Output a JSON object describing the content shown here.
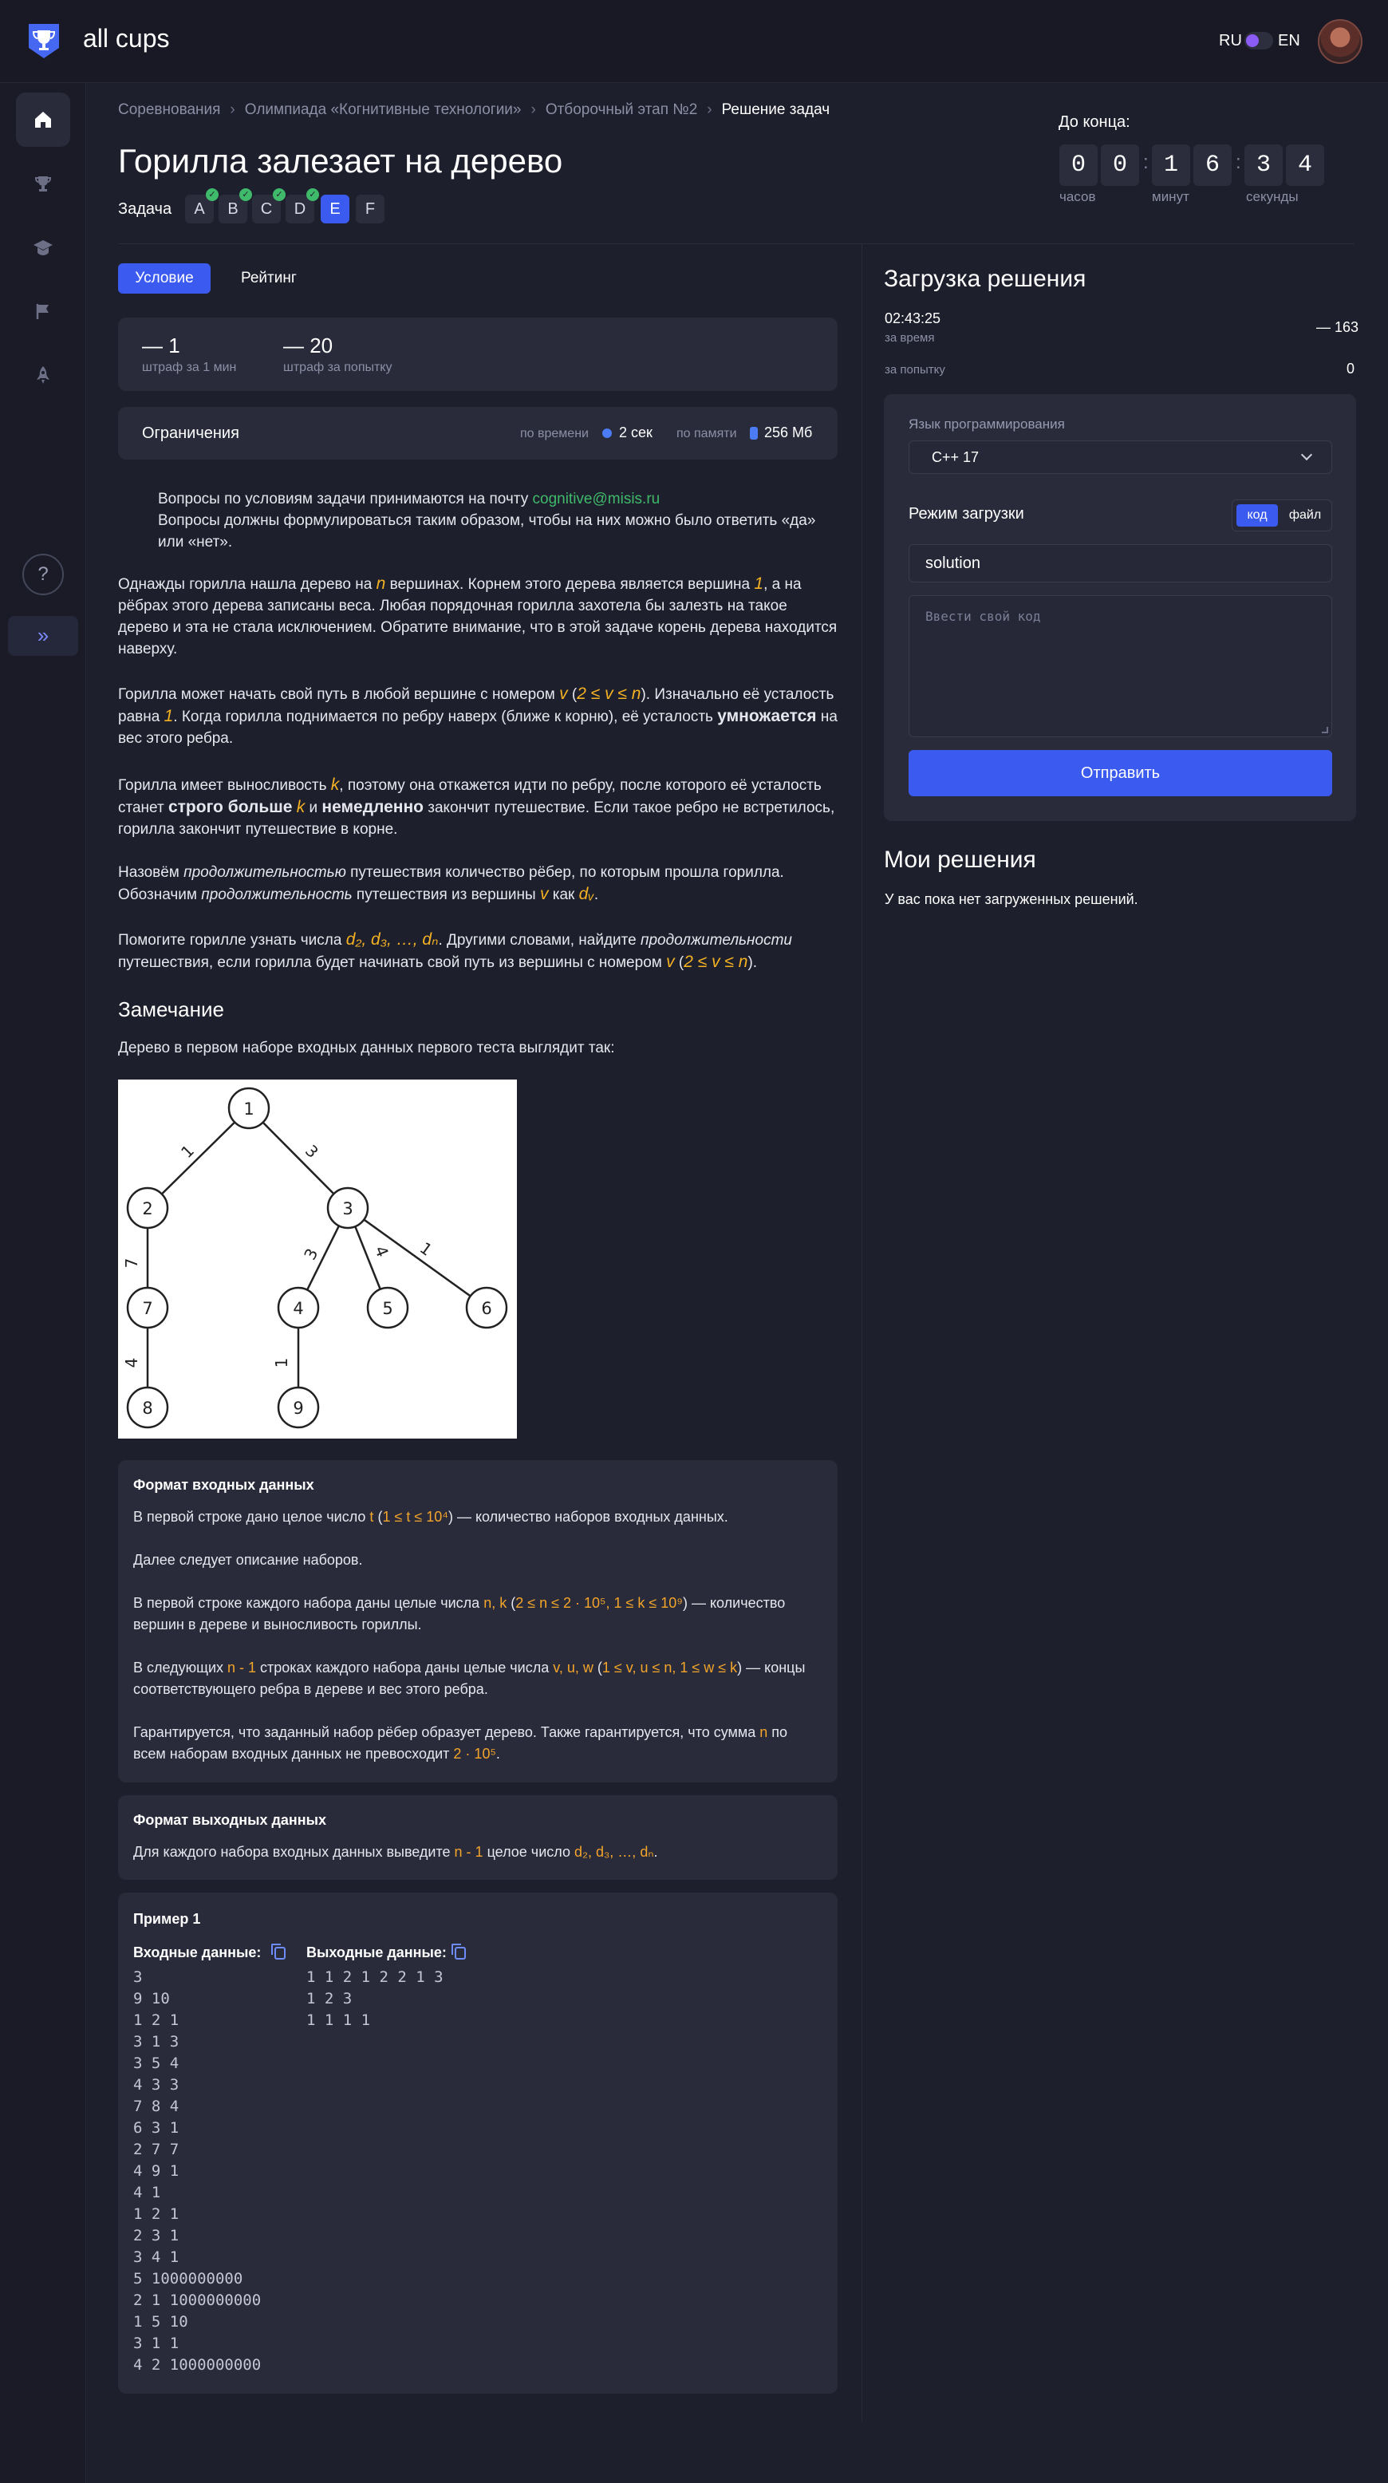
{
  "header": {
    "logo_text": "all cups",
    "lang_ru": "RU",
    "lang_en": "EN"
  },
  "sidebar": {
    "items": [
      "home-icon",
      "trophy-icon",
      "hat-icon",
      "flag-icon",
      "rocket-icon"
    ],
    "help": "?",
    "expand": "»"
  },
  "breadcrumbs": [
    "Соревнования",
    "Олимпиада «Когнитивные технологии»",
    "Отборочный этап №2",
    "Решение задач"
  ],
  "problem": {
    "title": "Горилла залезает на дерево",
    "task_label": "Задача",
    "tasks": [
      {
        "letter": "A",
        "solved": true
      },
      {
        "letter": "B",
        "solved": true
      },
      {
        "letter": "C",
        "solved": true
      },
      {
        "letter": "D",
        "solved": true
      },
      {
        "letter": "E",
        "solved": false,
        "current": true
      },
      {
        "letter": "F",
        "solved": false
      }
    ]
  },
  "timer": {
    "label": "До конца:",
    "digits": [
      "0",
      "0",
      "1",
      "6",
      "3",
      "4"
    ],
    "units": [
      "часов",
      "минут",
      "секунды"
    ]
  },
  "tabs": {
    "condition": "Условие",
    "rating": "Рейтинг"
  },
  "penalties": {
    "per_minute_value": "— 1",
    "per_minute_caption": "штраф за 1 мин",
    "per_attempt_value": "— 20",
    "per_attempt_caption": "штраф за попытку"
  },
  "limits": {
    "title": "Ограничения",
    "time_caption": "по времени",
    "time_value": "2 сек",
    "memory_caption": "по памяти",
    "memory_value": "256 Мб"
  },
  "notice": {
    "line1": "Вопросы по условиям задачи принимаются на почту ",
    "email": "cognitive@misis.ru",
    "line2": "Вопросы должны формулироваться таким образом, чтобы на них можно было ответить «да» или «нет»."
  },
  "statement": {
    "p1_a": "Однажды горилла нашла дерево на ",
    "p1_n": "n",
    "p1_b": " вершинах. Корнем этого дерева является вершина ",
    "p1_one": "1",
    "p1_c": ", а на рёбрах этого дерева записаны веса. Любая порядочная горилла захотела бы залезть на такое дерево и эта не стала исключением. Обратите внимание, что в этой задаче корень дерева находится наверху.",
    "p2_a": "Горилла может начать свой путь в любой вершине с номером ",
    "p2_v": "v",
    "p2_open": " (",
    "p2_range": "2 ≤ v ≤ n",
    "p2_b": "). Изначально её усталость равна ",
    "p2_one": "1",
    "p2_c": ". Когда горилла поднимается по ребру наверх (ближе к корню), её усталость ",
    "p2_bold": "умножается",
    "p2_d": " на вес этого ребра.",
    "p3_a": "Горилла имеет выносливость ",
    "p3_k": "k",
    "p3_b": ", поэтому она откажется идти по ребру, после которого её усталость станет ",
    "p3_bold1": "строго больше",
    "p3_k2": "k",
    "p3_and": " и ",
    "p3_bold2": "немедленно",
    "p3_c": " закончит путешествие. Если такое ребро не встретилось, горилла закончит путешествие в корне.",
    "p4_a": "Назовём ",
    "p4_i1": "продолжительностью",
    "p4_b": " путешествия количество рёбер, по которым прошла горилла. Обозначим ",
    "p4_i2": "продолжительность",
    "p4_c": " путешествия из вершины ",
    "p4_v": "v",
    "p4_as": " как ",
    "p4_dv": "dᵥ",
    "p4_end": ".",
    "p5_a": "Помогите горилле узнать числа ",
    "p5_d": "d₂, d₃, …, dₙ",
    "p5_b": ". Другими словами, найдите ",
    "p5_i": "продолжительности",
    "p5_c": " путешествия, если горилла будет начинать свой путь из вершины с номером ",
    "p5_v": "v",
    "p5_open": " (",
    "p5_range": "2 ≤ v ≤ n",
    "p5_end": ")."
  },
  "note": {
    "title": "Замечание",
    "text": "Дерево в первом наборе входных данных первого теста выглядит так:"
  },
  "tree": {
    "nodes": [
      "1",
      "2",
      "3",
      "4",
      "5",
      "6",
      "7",
      "8",
      "9"
    ],
    "edge_weights": [
      "1",
      "3",
      "7",
      "3",
      "4",
      "1",
      "4",
      "1"
    ]
  },
  "input_format": {
    "title": "Формат входных данных",
    "p1_a": "В первой строке дано целое число ",
    "p1_t": "t",
    "p1_open": " (",
    "p1_range": "1 ≤ t ≤ 10⁴",
    "p1_b": ") — количество наборов входных данных.",
    "p2": "Далее следует описание наборов.",
    "p3_a": "В первой строке каждого набора даны целые числа ",
    "p3_nk": "n, k",
    "p3_open": " (",
    "p3_range": "2 ≤ n ≤ 2 · 10⁵, 1 ≤ k ≤ 10⁹",
    "p3_b": ") — количество вершин в дереве и выносливость гориллы.",
    "p4_a": "В следующих ",
    "p4_n": "n - 1",
    "p4_b": " строках каждого набора даны целые числа ",
    "p4_vars": "v, u, w",
    "p4_open": " (",
    "p4_range": "1 ≤ v, u ≤ n, 1 ≤ w ≤ k",
    "p4_c": ") — концы соответствующего ребра в дереве и вес этого ребра.",
    "p5_a": "Гарантируется, что заданный набор рёбер образует дерево. Также гарантируется, что сумма ",
    "p5_n": "n",
    "p5_b": " по всем наборам входных данных не превосходит ",
    "p5_limit": "2 · 10⁵",
    "p5_end": "."
  },
  "output_format": {
    "title": "Формат выходных данных",
    "a": "Для каждого набора входных данных выведите ",
    "n": "n - 1",
    "b": " целое число ",
    "d": "d₂, d₃, …, dₙ",
    "end": "."
  },
  "example": {
    "title": "Пример 1",
    "input_label": "Входные данные:",
    "output_label": "Выходные данные:",
    "input_lines": [
      "3",
      "9 10",
      "1 2 1",
      "3 1 3",
      "3 5 4",
      "4 3 3",
      "7 8 4",
      "6 3 1",
      "2 7 7",
      "4 9 1",
      "4 1",
      "1 2 1",
      "2 3 1",
      "3 4 1",
      "5 1000000000",
      "2 1 1000000000",
      "1 5 10",
      "3 1 1",
      "4 2 1000000000"
    ],
    "output_lines": [
      "1 1 2 1 2 2 1 3",
      "1 2 3",
      "1 1 1 1"
    ]
  },
  "submission": {
    "title": "Загрузка решения",
    "time_value": "02:43:25",
    "time_caption": "за время",
    "time_penalty": "— 163",
    "attempt_caption": "за попытку",
    "attempt_value": "0",
    "lang_label": "Язык программирования",
    "lang_value": "C++ 17",
    "mode_label": "Режим загрузки",
    "mode_code": "код",
    "mode_file": "файл",
    "filename": "solution",
    "code_placeholder": "Ввести свой код",
    "submit": "Отправить"
  },
  "my_solutions": {
    "title": "Мои решения",
    "empty": "У вас пока нет загруженных решений."
  },
  "colors": {
    "accent": "#3b5bf0",
    "highlight": "#f4b223",
    "success": "#3fb96a",
    "background": "#1e1f2c",
    "panel": "#292b3a"
  }
}
